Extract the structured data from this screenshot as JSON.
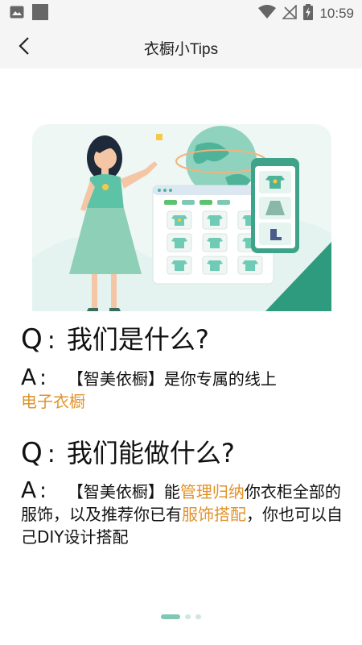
{
  "status_bar": {
    "time": "10:59",
    "icons": [
      "image-icon",
      "square-icon",
      "wifi-icon",
      "no-signal-icon",
      "battery-charging-icon"
    ]
  },
  "nav": {
    "title": "衣橱小Tips",
    "back_icon": "back-chevron-icon"
  },
  "content": {
    "q1": {
      "q_letter": "Q",
      "colon": ":",
      "question": "我们是什么?"
    },
    "a1": {
      "a_letter": "A",
      "colon": ":",
      "text": "【智美依橱】是你专属的线上",
      "highlight": "电子衣橱"
    },
    "q2": {
      "q_letter": "Q",
      "colon": ":",
      "question": "我们能做什么?"
    },
    "a2": {
      "a_letter": "A",
      "colon": ":",
      "part1": "【智美依橱】能",
      "hl1": "管理归纳",
      "part2": "你衣柜全部的服饰，以及推荐你已有",
      "hl2": "服饰搭配",
      "part3": "，你也可以自己DIY设计搭配"
    }
  },
  "pager": {
    "pages": 3,
    "active_index": 0
  },
  "colors": {
    "accent": "#e0932a",
    "teal": "#7fc8b4",
    "bar_bg": "#f5f5f5"
  }
}
